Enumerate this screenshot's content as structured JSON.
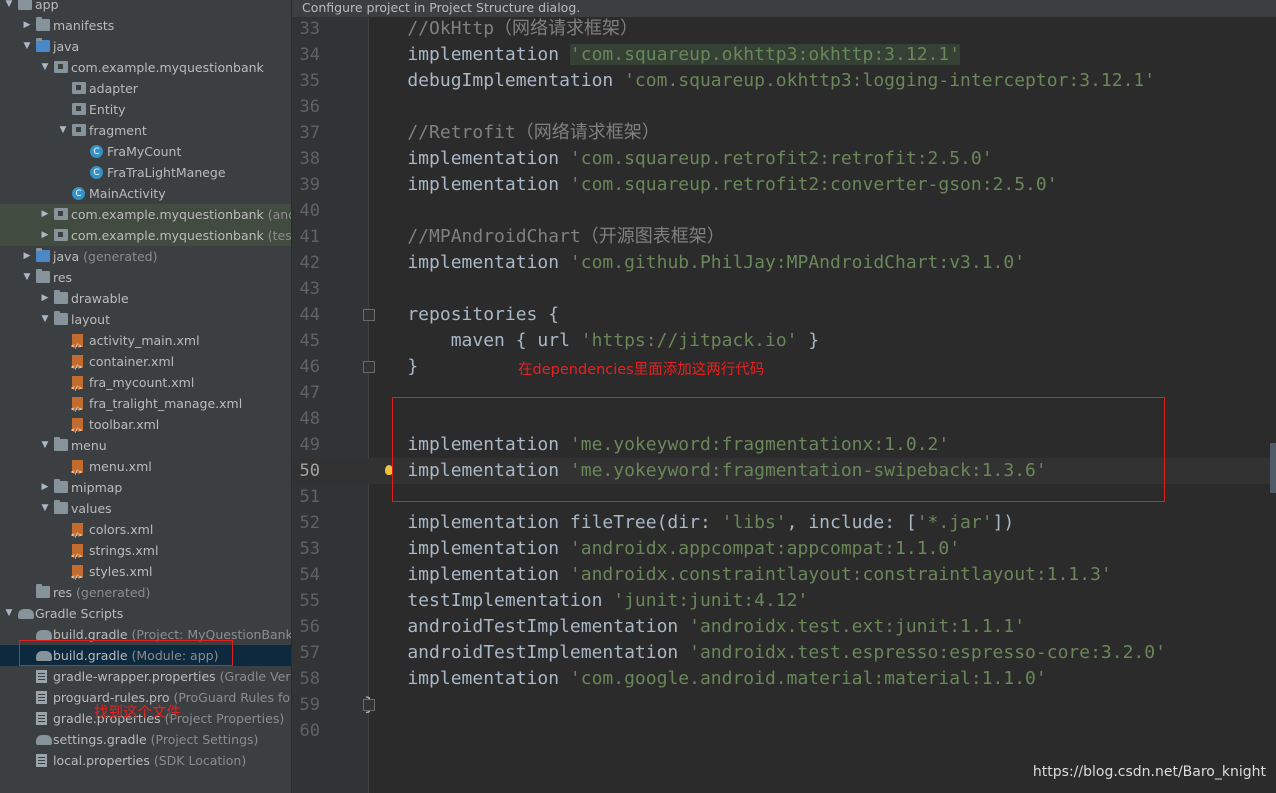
{
  "project_tree": [
    {
      "label": "app",
      "indent": 0,
      "icon": "folder-icon",
      "arrow": "▼",
      "name": "tree-item-app"
    },
    {
      "label": "manifests",
      "indent": 1,
      "icon": "folder-icon",
      "arrow": "▶",
      "name": "tree-item-manifests"
    },
    {
      "label": "java",
      "indent": 1,
      "icon": "java-folder-icon",
      "arrow": "▼",
      "name": "tree-item-java"
    },
    {
      "label": "com.example.myquestionbank",
      "indent": 2,
      "icon": "package-icon",
      "arrow": "▼",
      "name": "tree-item-package-main"
    },
    {
      "label": "adapter",
      "indent": 3,
      "icon": "package-icon",
      "arrow": "",
      "name": "tree-item-adapter"
    },
    {
      "label": "Entity",
      "indent": 3,
      "icon": "package-icon",
      "arrow": "",
      "name": "tree-item-entity"
    },
    {
      "label": "fragment",
      "indent": 3,
      "icon": "package-icon",
      "arrow": "▼",
      "name": "tree-item-fragment"
    },
    {
      "label": "FraMyCount",
      "indent": 4,
      "icon": "class-icon",
      "arrow": "",
      "name": "tree-item-framycount"
    },
    {
      "label": "FraTraLightManege",
      "indent": 4,
      "icon": "class-icon",
      "arrow": "",
      "name": "tree-item-fratralightmanege"
    },
    {
      "label": "MainActivity",
      "indent": 3,
      "icon": "class-icon",
      "arrow": "",
      "name": "tree-item-mainactivity"
    },
    {
      "label": "com.example.myquestionbank",
      "hint": " (andro",
      "indent": 2,
      "icon": "package-icon",
      "arrow": "▶",
      "hl": true,
      "name": "tree-item-package-android-test"
    },
    {
      "label": "com.example.myquestionbank",
      "hint": " (test)",
      "indent": 2,
      "icon": "package-icon",
      "arrow": "▶",
      "hl": true,
      "name": "tree-item-package-test"
    },
    {
      "label": "java",
      "hint": " (generated)",
      "indent": 1,
      "icon": "java-folder-icon",
      "arrow": "▶",
      "name": "tree-item-java-generated"
    },
    {
      "label": "res",
      "indent": 1,
      "icon": "folder-icon",
      "arrow": "▼",
      "name": "tree-item-res"
    },
    {
      "label": "drawable",
      "indent": 2,
      "icon": "folder-icon",
      "arrow": "▶",
      "name": "tree-item-drawable"
    },
    {
      "label": "layout",
      "indent": 2,
      "icon": "folder-icon",
      "arrow": "▼",
      "name": "tree-item-layout"
    },
    {
      "label": "activity_main.xml",
      "indent": 3,
      "icon": "xml-icon",
      "arrow": "",
      "name": "tree-item-activity-main-xml"
    },
    {
      "label": "container.xml",
      "indent": 3,
      "icon": "xml-icon",
      "arrow": "",
      "name": "tree-item-container-xml"
    },
    {
      "label": "fra_mycount.xml",
      "indent": 3,
      "icon": "xml-icon",
      "arrow": "",
      "name": "tree-item-fra-mycount-xml"
    },
    {
      "label": "fra_tralight_manage.xml",
      "indent": 3,
      "icon": "xml-icon",
      "arrow": "",
      "name": "tree-item-fra-tralight-manage-xml"
    },
    {
      "label": "toolbar.xml",
      "indent": 3,
      "icon": "xml-icon",
      "arrow": "",
      "name": "tree-item-toolbar-xml"
    },
    {
      "label": "menu",
      "indent": 2,
      "icon": "folder-icon",
      "arrow": "▼",
      "name": "tree-item-menu"
    },
    {
      "label": "menu.xml",
      "indent": 3,
      "icon": "xml-icon",
      "arrow": "",
      "name": "tree-item-menu-xml"
    },
    {
      "label": "mipmap",
      "indent": 2,
      "icon": "folder-icon",
      "arrow": "▶",
      "name": "tree-item-mipmap"
    },
    {
      "label": "values",
      "indent": 2,
      "icon": "folder-icon",
      "arrow": "▼",
      "name": "tree-item-values"
    },
    {
      "label": "colors.xml",
      "indent": 3,
      "icon": "xml-icon",
      "arrow": "",
      "name": "tree-item-colors-xml"
    },
    {
      "label": "strings.xml",
      "indent": 3,
      "icon": "xml-icon",
      "arrow": "",
      "name": "tree-item-strings-xml"
    },
    {
      "label": "styles.xml",
      "indent": 3,
      "icon": "xml-icon",
      "arrow": "",
      "name": "tree-item-styles-xml"
    },
    {
      "label": "res",
      "hint": " (generated)",
      "indent": 1,
      "icon": "folder-icon",
      "arrow": "",
      "name": "tree-item-res-generated"
    },
    {
      "label": "Gradle Scripts",
      "indent": 0,
      "icon": "gradle-icon",
      "arrow": "▼",
      "name": "tree-item-gradle-scripts"
    },
    {
      "label": "build.gradle",
      "hint": " (Project: MyQuestionBank)",
      "indent": 1,
      "icon": "gradle-icon",
      "arrow": "",
      "name": "tree-item-build-gradle-project"
    },
    {
      "label": "build.gradle",
      "hint": " (Module: app)",
      "indent": 1,
      "icon": "gradle-icon",
      "arrow": "",
      "sel": true,
      "name": "tree-item-build-gradle-module"
    },
    {
      "label": "gradle-wrapper.properties",
      "hint": " (Gradle Versio",
      "indent": 1,
      "icon": "properties-icon",
      "arrow": "",
      "name": "tree-item-gradle-wrapper"
    },
    {
      "label": "proguard-rules.pro",
      "hint": " (ProGuard Rules for",
      "indent": 1,
      "icon": "properties-icon",
      "arrow": "",
      "name": "tree-item-proguard"
    },
    {
      "label": "gradle.properties",
      "hint": " (Project Properties)",
      "indent": 1,
      "icon": "properties-icon",
      "arrow": "",
      "name": "tree-item-gradle-properties"
    },
    {
      "label": "settings.gradle",
      "hint": " (Project Settings)",
      "indent": 1,
      "icon": "gradle-icon",
      "arrow": "",
      "name": "tree-item-settings-gradle"
    },
    {
      "label": "local.properties",
      "hint": " (SDK Location)",
      "indent": 1,
      "icon": "properties-icon",
      "arrow": "",
      "name": "tree-item-local-properties"
    }
  ],
  "editor": {
    "banner": "Configure project in Project Structure dialog.",
    "lines": [
      {
        "n": "33",
        "parts": [
          [
            "c-com",
            "    //OkHttp（网络请求框架）"
          ]
        ]
      },
      {
        "n": "34",
        "parts": [
          [
            "",
            "    implementation "
          ],
          [
            "c-str c-hl",
            "'com.squareup.okhttp3:okhttp:3.12.1'"
          ]
        ]
      },
      {
        "n": "35",
        "parts": [
          [
            "",
            "    debugImplementation "
          ],
          [
            "c-str",
            "'com.squareup.okhttp3:logging-interceptor:3.12.1'"
          ]
        ]
      },
      {
        "n": "36",
        "parts": []
      },
      {
        "n": "37",
        "parts": [
          [
            "c-com",
            "    //Retrofit（网络请求框架）"
          ]
        ]
      },
      {
        "n": "38",
        "parts": [
          [
            "",
            "    implementation "
          ],
          [
            "c-str",
            "'com.squareup.retrofit2:retrofit:2.5.0'"
          ]
        ]
      },
      {
        "n": "39",
        "parts": [
          [
            "",
            "    implementation "
          ],
          [
            "c-str",
            "'com.squareup.retrofit2:converter-gson:2.5.0'"
          ]
        ]
      },
      {
        "n": "40",
        "parts": []
      },
      {
        "n": "41",
        "parts": [
          [
            "c-com",
            "    //MPAndroidChart（开源图表框架）"
          ]
        ]
      },
      {
        "n": "42",
        "parts": [
          [
            "",
            "    implementation "
          ],
          [
            "c-str",
            "'com.github.PhilJay:MPAndroidChart:v3.1.0'"
          ]
        ]
      },
      {
        "n": "43",
        "parts": []
      },
      {
        "n": "44",
        "parts": [
          [
            "",
            "    repositories {"
          ]
        ],
        "fold": true
      },
      {
        "n": "45",
        "parts": [
          [
            "",
            "        maven { url "
          ],
          [
            "c-str",
            "'https://jitpack.io'"
          ],
          [
            "",
            " }"
          ]
        ]
      },
      {
        "n": "46",
        "parts": [
          [
            "",
            "    }"
          ]
        ],
        "fold": true
      },
      {
        "n": "47",
        "parts": []
      },
      {
        "n": "48",
        "parts": []
      },
      {
        "n": "49",
        "parts": [
          [
            "",
            "    implementation "
          ],
          [
            "c-str",
            "'me.yokeyword:fragmentationx:1.0.2'"
          ]
        ]
      },
      {
        "n": "50",
        "parts": [
          [
            "",
            "    implementation "
          ],
          [
            "c-str",
            "'me.yokeyword:fragmentation-swipeback:1.3.6'"
          ]
        ],
        "cur": true,
        "bulb": true
      },
      {
        "n": "51",
        "parts": []
      },
      {
        "n": "52",
        "parts": [
          [
            "",
            "    implementation fileTree(dir: "
          ],
          [
            "c-str",
            "'libs'"
          ],
          [
            "",
            ", include: ["
          ],
          [
            "c-str",
            "'*.jar'"
          ],
          [
            "",
            "])"
          ]
        ]
      },
      {
        "n": "53",
        "parts": [
          [
            "",
            "    implementation "
          ],
          [
            "c-str",
            "'androidx.appcompat:appcompat:1.1.0'"
          ]
        ]
      },
      {
        "n": "54",
        "parts": [
          [
            "",
            "    implementation "
          ],
          [
            "c-str",
            "'androidx.constraintlayout:constraintlayout:1.1.3'"
          ]
        ]
      },
      {
        "n": "55",
        "parts": [
          [
            "",
            "    testImplementation "
          ],
          [
            "c-str",
            "'junit:junit:4.12'"
          ]
        ]
      },
      {
        "n": "56",
        "parts": [
          [
            "",
            "    androidTestImplementation "
          ],
          [
            "c-str",
            "'androidx.test.ext:junit:1.1.1'"
          ]
        ]
      },
      {
        "n": "57",
        "parts": [
          [
            "",
            "    androidTestImplementation "
          ],
          [
            "c-str",
            "'androidx.test.espresso:espresso-core:3.2.0'"
          ]
        ]
      },
      {
        "n": "58",
        "parts": [
          [
            "",
            "    implementation "
          ],
          [
            "c-str",
            "'com.google.android.material:material:1.1.0'"
          ]
        ]
      },
      {
        "n": "59",
        "parts": [
          [
            "",
            "}"
          ]
        ],
        "fold": true
      },
      {
        "n": "60",
        "parts": []
      }
    ]
  },
  "annotations": {
    "code_note": "在dependencies里面添加这两行代码",
    "file_note": "找到这个文件",
    "color": "#e02020"
  },
  "watermark": "https://blog.csdn.net/Baro_knight"
}
